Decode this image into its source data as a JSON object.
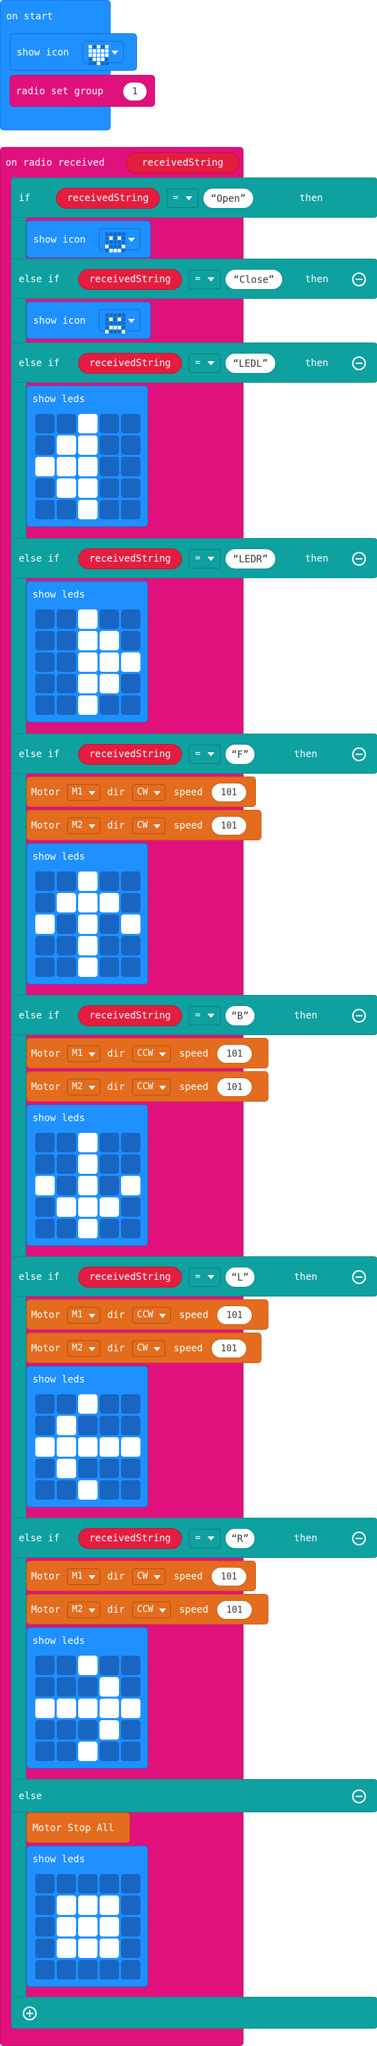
{
  "on_start": {
    "hat_label": "on start",
    "show_icon_label": "show icon",
    "show_icon_name": "heart-icon",
    "radio_group_label": "radio set group",
    "radio_group_value": "1"
  },
  "radio": {
    "hat_label": "on radio received",
    "param": "receivedString"
  },
  "keywords": {
    "if": "if",
    "else_if": "else if",
    "else": "else",
    "then": "then",
    "eq": "=",
    "show_icon": "show icon",
    "show_leds": "show leds",
    "motor": "Motor",
    "dir": "dir",
    "speed": "speed",
    "motor_stop": "Motor Stop All"
  },
  "branches": [
    {
      "kind": "if",
      "var": "receivedString",
      "value": "Open",
      "action": "show icon",
      "icon": "happy-icon"
    },
    {
      "kind": "else if",
      "var": "receivedString",
      "value": "Close",
      "action": "show icon",
      "icon": "sad-icon"
    },
    {
      "kind": "else if",
      "var": "receivedString",
      "value": "LEDL",
      "leds": [
        0,
        0,
        1,
        0,
        0,
        0,
        1,
        1,
        0,
        0,
        1,
        1,
        1,
        0,
        0,
        0,
        1,
        1,
        0,
        0,
        0,
        0,
        1,
        0,
        0
      ]
    },
    {
      "kind": "else if",
      "var": "receivedString",
      "value": "LEDR",
      "leds": [
        0,
        0,
        1,
        0,
        0,
        0,
        0,
        1,
        1,
        0,
        0,
        0,
        1,
        1,
        1,
        0,
        0,
        1,
        1,
        0,
        0,
        0,
        1,
        0,
        0
      ]
    },
    {
      "kind": "else if",
      "var": "receivedString",
      "value": "F",
      "motors": [
        {
          "motor": "M1",
          "dir": "CW",
          "speed": "101"
        },
        {
          "motor": "M2",
          "dir": "CW",
          "speed": "101"
        }
      ],
      "leds": [
        0,
        0,
        1,
        0,
        0,
        0,
        1,
        1,
        1,
        0,
        1,
        0,
        1,
        0,
        1,
        0,
        0,
        1,
        0,
        0,
        0,
        0,
        1,
        0,
        0
      ]
    },
    {
      "kind": "else if",
      "var": "receivedString",
      "value": "B",
      "motors": [
        {
          "motor": "M1",
          "dir": "CCW",
          "speed": "101"
        },
        {
          "motor": "M2",
          "dir": "CCW",
          "speed": "101"
        }
      ],
      "leds": [
        0,
        0,
        1,
        0,
        0,
        0,
        0,
        1,
        0,
        0,
        1,
        0,
        1,
        0,
        1,
        0,
        1,
        1,
        1,
        0,
        0,
        0,
        1,
        0,
        0
      ]
    },
    {
      "kind": "else if",
      "var": "receivedString",
      "value": "L",
      "motors": [
        {
          "motor": "M1",
          "dir": "CCW",
          "speed": "101"
        },
        {
          "motor": "M2",
          "dir": "CW",
          "speed": "101"
        }
      ],
      "leds": [
        0,
        0,
        1,
        0,
        0,
        0,
        1,
        0,
        0,
        0,
        1,
        1,
        1,
        1,
        1,
        0,
        1,
        0,
        0,
        0,
        0,
        0,
        1,
        0,
        0
      ]
    },
    {
      "kind": "else if",
      "var": "receivedString",
      "value": "R",
      "motors": [
        {
          "motor": "M1",
          "dir": "CW",
          "speed": "101"
        },
        {
          "motor": "M2",
          "dir": "CCW",
          "speed": "101"
        }
      ],
      "leds": [
        0,
        0,
        1,
        0,
        0,
        0,
        0,
        0,
        1,
        0,
        1,
        1,
        1,
        1,
        1,
        0,
        0,
        0,
        1,
        0,
        0,
        0,
        1,
        0,
        0
      ]
    },
    {
      "kind": "else",
      "action": "Motor Stop All",
      "leds": [
        0,
        0,
        0,
        0,
        0,
        0,
        1,
        1,
        1,
        0,
        0,
        1,
        1,
        1,
        0,
        0,
        1,
        1,
        1,
        0,
        0,
        0,
        0,
        0,
        0
      ]
    }
  ]
}
